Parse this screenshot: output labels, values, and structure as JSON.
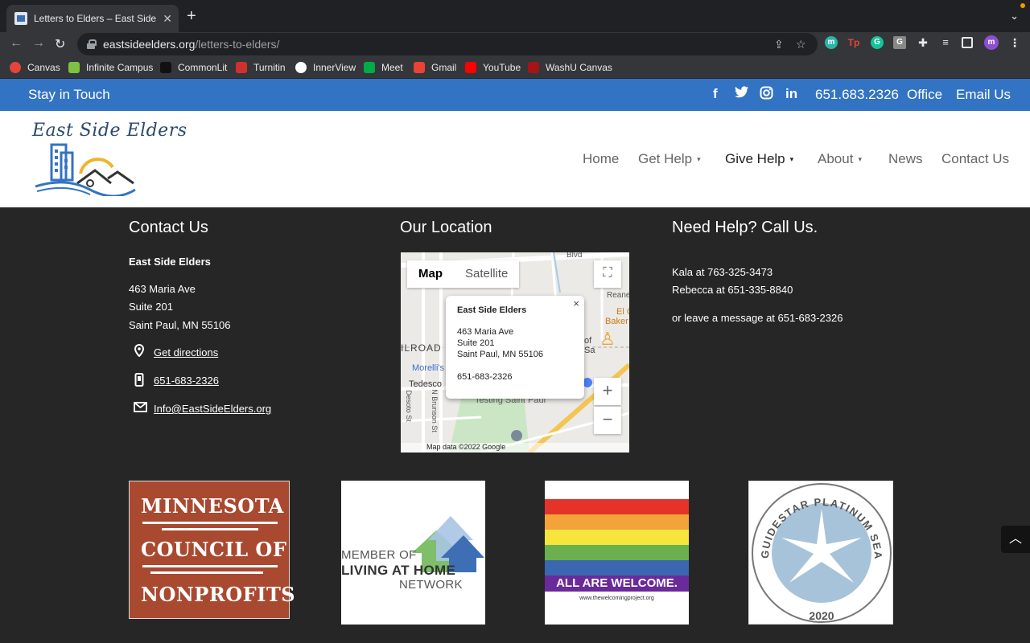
{
  "browser": {
    "tab_title": "Letters to Elders – East Side Eld",
    "new_tab": "+",
    "url_host": "eastsideelders.org",
    "url_path": "/letters-to-elders/",
    "bookmarks": [
      {
        "label": "Canvas",
        "color": "#e4453a"
      },
      {
        "label": "Infinite Campus",
        "color": "#7dc242"
      },
      {
        "label": "CommonLit",
        "color": "#222222"
      },
      {
        "label": "Turnitin",
        "color": "#d0312d"
      },
      {
        "label": "InnerView",
        "color": "#ffffff"
      },
      {
        "label": "Meet",
        "color": "#00ac47"
      },
      {
        "label": "Gmail",
        "color": "#ea4335"
      },
      {
        "label": "YouTube",
        "color": "#ff0000"
      },
      {
        "label": "WashU Canvas",
        "color": "#a51417"
      }
    ],
    "profile_initial": "m"
  },
  "topbar": {
    "stay": "Stay in Touch",
    "phone": "651.683.2326",
    "office": "Office",
    "email": "Email Us",
    "social_icons": [
      "facebook-icon",
      "twitter-icon",
      "instagram-icon",
      "linkedin-icon"
    ]
  },
  "header": {
    "logo_text": "East Side Elders",
    "menu": [
      {
        "label": "Home",
        "dropdown": false
      },
      {
        "label": "Get Help",
        "dropdown": true
      },
      {
        "label": "Give Help",
        "dropdown": true
      },
      {
        "label": "About",
        "dropdown": true
      },
      {
        "label": "News",
        "dropdown": false
      },
      {
        "label": "Contact Us",
        "dropdown": false
      }
    ]
  },
  "contact": {
    "title": "Contact Us",
    "org": "East Side Elders",
    "address1": "463 Maria Ave",
    "address2": "Suite 201",
    "address3": "Saint Paul, MN 55106",
    "directions": "Get directions",
    "phone": "651-683-2326",
    "email": "Info@EastSideElders.org"
  },
  "location": {
    "title": "Our Location",
    "map_tab": "Map",
    "satellite_tab": "Satellite",
    "info_title": "East Side Elders",
    "info_address1": "463 Maria Ave",
    "info_address2": "Suite 201",
    "info_address3": "Saint Paul, MN 55106",
    "info_phone": "651-683-2326",
    "map_attribution": "Map data ©2022 Google",
    "labels": {
      "blvd": "Blvd",
      "reaney": "Reaney",
      "ilroad": "ILROAD",
      "morellis": "Morelli's",
      "tedesco": "Tedesco",
      "testing": "Testing Saint Paul",
      "desoto": "Desoto St",
      "brunson": "N Brunson St",
      "el": "El C",
      "baker": "Baker",
      "of": "of",
      "sa": "Sa"
    }
  },
  "help": {
    "title": "Need Help?  Call Us.",
    "line1": "Kala at 763-325-3473",
    "line2": "Rebecca at 651-335-8840",
    "line3": "or leave a message at 651-683-2326"
  },
  "badges": {
    "mcn": [
      "MINNESOTA",
      "COUNCIL OF",
      "NONPROFITS"
    ],
    "lah": [
      "MEMBER OF",
      "LIVING AT HOME",
      "NETWORK"
    ],
    "welcome": "ALL ARE WELCOME.",
    "welcome_url": "www.thewelcomingproject.org",
    "guidestar_text": "GUIDESTAR PLATINUM SEAL OF TRANSPARENCY",
    "guidestar_year": "2020",
    "rainbow_colors": [
      "#e5332a",
      "#f2a33a",
      "#f6e53c",
      "#6ab04c",
      "#3a67b0"
    ]
  }
}
